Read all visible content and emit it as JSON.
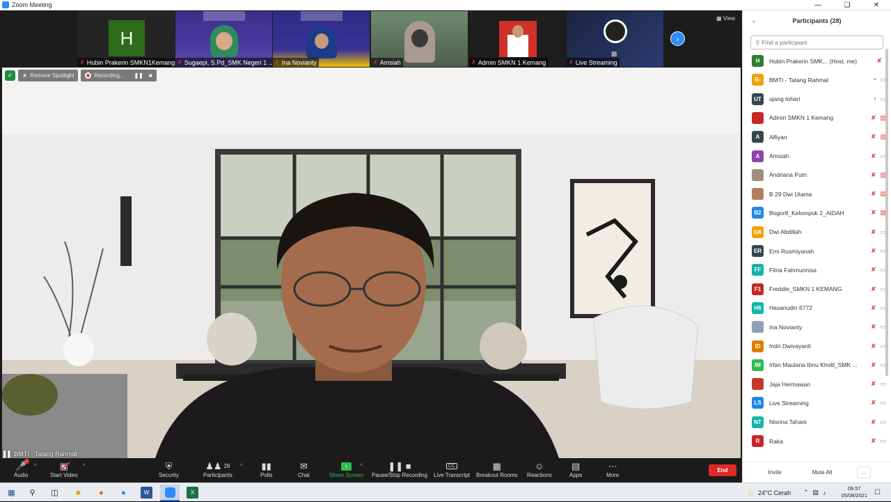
{
  "window": {
    "title": "Zoom Meeting"
  },
  "strip": {
    "view_label": "View",
    "tiles": [
      {
        "name": "Hubin Prakerin SMKN1Kemang",
        "initial": "H",
        "kind": "initial"
      },
      {
        "name": "Sugaepi, S.Pd_SMK Negeri 1 ...",
        "kind": "video"
      },
      {
        "name": "Ina Novianty",
        "kind": "video"
      },
      {
        "name": "Amsiah",
        "kind": "video"
      },
      {
        "name": "Admin SMKN 1 Kemang",
        "kind": "video"
      },
      {
        "name": "Live Streaming",
        "kind": "video"
      }
    ]
  },
  "main": {
    "remove_spotlight": "Remove Spotlight",
    "recording": "Recording...",
    "speaker": "BMTI - Tatang Rahmat"
  },
  "controls": {
    "audio": "Audio",
    "start_video": "Start Video",
    "security": "Security",
    "participants": "Participants",
    "participants_count": "28",
    "polls": "Polls",
    "chat": "Chat",
    "share_screen": "Share Screen",
    "recording": "Pause/Stop Recording",
    "transcript": "Live Transcript",
    "transcript_icon": "CC",
    "breakout": "Breakout Rooms",
    "reactions": "Reactions",
    "apps": "Apps",
    "more": "More",
    "end": "End"
  },
  "panel": {
    "title": "Participants (28)",
    "search_placeholder": "Find a participant",
    "invite": "Invite",
    "mute_all": "Mute All",
    "more": "...",
    "participants": [
      {
        "name": "Hubin Prakerin SMK...  (Host, me)",
        "initials": "H",
        "color": "#2e7d32",
        "mic": "muted",
        "cam": "none"
      },
      {
        "name": "BMTI - Tatang Rahmat",
        "initials": "B-",
        "color": "#f0a30a",
        "mic": "on",
        "cam": "on"
      },
      {
        "name": "ujang tohari",
        "initials": "UT",
        "color": "#37474f",
        "mic": "on",
        "cam": "on"
      },
      {
        "name": "Admin SMKN 1 Kemang",
        "initials": "",
        "color": "#c62828",
        "mic": "muted",
        "cam": "off"
      },
      {
        "name": "Alfiyan",
        "initials": "A",
        "color": "#37474f",
        "mic": "muted",
        "cam": "off"
      },
      {
        "name": "Amsiah",
        "initials": "A",
        "color": "#8e44ad",
        "mic": "muted",
        "cam": "on"
      },
      {
        "name": "Andriana Putri",
        "initials": "",
        "color": "#9e8e80",
        "mic": "muted",
        "cam": "off"
      },
      {
        "name": "B 29 Dwi Utama",
        "initials": "",
        "color": "#b08060",
        "mic": "muted",
        "cam": "off"
      },
      {
        "name": "Bogor8_Kelompok 2_AIDAH",
        "initials": "B2",
        "color": "#1e88e5",
        "mic": "muted",
        "cam": "off"
      },
      {
        "name": "Dwi Abdillah",
        "initials": "DA",
        "color": "#f0a30a",
        "mic": "muted",
        "cam": "on"
      },
      {
        "name": "Emi Rusmiyanah",
        "initials": "ER",
        "color": "#37474f",
        "mic": "muted",
        "cam": "on"
      },
      {
        "name": "Fitria Fahmunnisa",
        "initials": "FF",
        "color": "#13b5a6",
        "mic": "muted",
        "cam": "on"
      },
      {
        "name": "Freddie_SMKN 1 KEMANG",
        "initials": "F1",
        "color": "#c62828",
        "mic": "muted",
        "cam": "on"
      },
      {
        "name": "Hasanudin 6772",
        "initials": "H6",
        "color": "#13b5a6",
        "mic": "muted",
        "cam": "on"
      },
      {
        "name": "Ina Novianty",
        "initials": "",
        "color": "#8fa0b8",
        "mic": "muted",
        "cam": "on"
      },
      {
        "name": "Indri Dwivayanti",
        "initials": "ID",
        "color": "#e07b00",
        "mic": "muted",
        "cam": "on"
      },
      {
        "name": "Irfan Maulana Ibnu Kholil_SMK ...",
        "initials": "IM",
        "color": "#2ebc4f",
        "mic": "muted",
        "cam": "on"
      },
      {
        "name": "Jaja Hermawan",
        "initials": "",
        "color": "#c0392b",
        "mic": "muted",
        "cam": "on"
      },
      {
        "name": "Live Streaming",
        "initials": "LS",
        "color": "#1e88e5",
        "mic": "muted",
        "cam": "on"
      },
      {
        "name": "Nisrina Tahani",
        "initials": "NT",
        "color": "#13b5a6",
        "mic": "muted",
        "cam": "on"
      },
      {
        "name": "Raka",
        "initials": "R",
        "color": "#c62828",
        "mic": "muted",
        "cam": "on"
      }
    ]
  },
  "taskbar": {
    "weather": "24°C  Cerah",
    "time": "09.57",
    "date": "05/08/2021"
  }
}
